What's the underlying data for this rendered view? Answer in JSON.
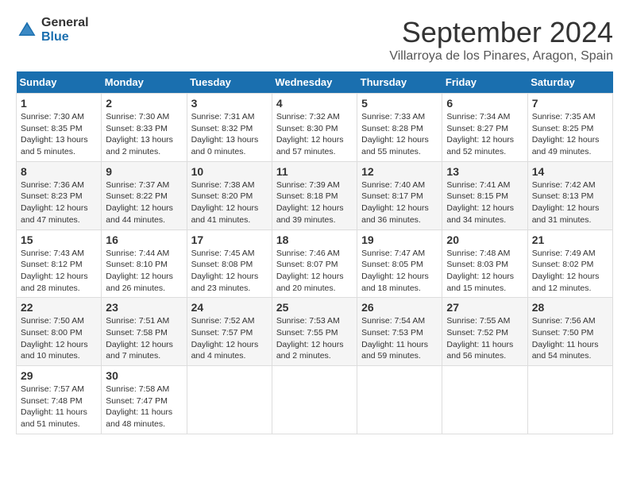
{
  "logo": {
    "general": "General",
    "blue": "Blue"
  },
  "title": "September 2024",
  "location": "Villarroya de los Pinares, Aragon, Spain",
  "weekdays": [
    "Sunday",
    "Monday",
    "Tuesday",
    "Wednesday",
    "Thursday",
    "Friday",
    "Saturday"
  ],
  "weeks": [
    [
      {
        "day": "1",
        "sunrise": "7:30 AM",
        "sunset": "8:35 PM",
        "daylight": "13 hours and 5 minutes."
      },
      {
        "day": "2",
        "sunrise": "7:30 AM",
        "sunset": "8:33 PM",
        "daylight": "13 hours and 2 minutes."
      },
      {
        "day": "3",
        "sunrise": "7:31 AM",
        "sunset": "8:32 PM",
        "daylight": "13 hours and 0 minutes."
      },
      {
        "day": "4",
        "sunrise": "7:32 AM",
        "sunset": "8:30 PM",
        "daylight": "12 hours and 57 minutes."
      },
      {
        "day": "5",
        "sunrise": "7:33 AM",
        "sunset": "8:28 PM",
        "daylight": "12 hours and 55 minutes."
      },
      {
        "day": "6",
        "sunrise": "7:34 AM",
        "sunset": "8:27 PM",
        "daylight": "12 hours and 52 minutes."
      },
      {
        "day": "7",
        "sunrise": "7:35 AM",
        "sunset": "8:25 PM",
        "daylight": "12 hours and 49 minutes."
      }
    ],
    [
      {
        "day": "8",
        "sunrise": "7:36 AM",
        "sunset": "8:23 PM",
        "daylight": "12 hours and 47 minutes."
      },
      {
        "day": "9",
        "sunrise": "7:37 AM",
        "sunset": "8:22 PM",
        "daylight": "12 hours and 44 minutes."
      },
      {
        "day": "10",
        "sunrise": "7:38 AM",
        "sunset": "8:20 PM",
        "daylight": "12 hours and 41 minutes."
      },
      {
        "day": "11",
        "sunrise": "7:39 AM",
        "sunset": "8:18 PM",
        "daylight": "12 hours and 39 minutes."
      },
      {
        "day": "12",
        "sunrise": "7:40 AM",
        "sunset": "8:17 PM",
        "daylight": "12 hours and 36 minutes."
      },
      {
        "day": "13",
        "sunrise": "7:41 AM",
        "sunset": "8:15 PM",
        "daylight": "12 hours and 34 minutes."
      },
      {
        "day": "14",
        "sunrise": "7:42 AM",
        "sunset": "8:13 PM",
        "daylight": "12 hours and 31 minutes."
      }
    ],
    [
      {
        "day": "15",
        "sunrise": "7:43 AM",
        "sunset": "8:12 PM",
        "daylight": "12 hours and 28 minutes."
      },
      {
        "day": "16",
        "sunrise": "7:44 AM",
        "sunset": "8:10 PM",
        "daylight": "12 hours and 26 minutes."
      },
      {
        "day": "17",
        "sunrise": "7:45 AM",
        "sunset": "8:08 PM",
        "daylight": "12 hours and 23 minutes."
      },
      {
        "day": "18",
        "sunrise": "7:46 AM",
        "sunset": "8:07 PM",
        "daylight": "12 hours and 20 minutes."
      },
      {
        "day": "19",
        "sunrise": "7:47 AM",
        "sunset": "8:05 PM",
        "daylight": "12 hours and 18 minutes."
      },
      {
        "day": "20",
        "sunrise": "7:48 AM",
        "sunset": "8:03 PM",
        "daylight": "12 hours and 15 minutes."
      },
      {
        "day": "21",
        "sunrise": "7:49 AM",
        "sunset": "8:02 PM",
        "daylight": "12 hours and 12 minutes."
      }
    ],
    [
      {
        "day": "22",
        "sunrise": "7:50 AM",
        "sunset": "8:00 PM",
        "daylight": "12 hours and 10 minutes."
      },
      {
        "day": "23",
        "sunrise": "7:51 AM",
        "sunset": "7:58 PM",
        "daylight": "12 hours and 7 minutes."
      },
      {
        "day": "24",
        "sunrise": "7:52 AM",
        "sunset": "7:57 PM",
        "daylight": "12 hours and 4 minutes."
      },
      {
        "day": "25",
        "sunrise": "7:53 AM",
        "sunset": "7:55 PM",
        "daylight": "12 hours and 2 minutes."
      },
      {
        "day": "26",
        "sunrise": "7:54 AM",
        "sunset": "7:53 PM",
        "daylight": "11 hours and 59 minutes."
      },
      {
        "day": "27",
        "sunrise": "7:55 AM",
        "sunset": "7:52 PM",
        "daylight": "11 hours and 56 minutes."
      },
      {
        "day": "28",
        "sunrise": "7:56 AM",
        "sunset": "7:50 PM",
        "daylight": "11 hours and 54 minutes."
      }
    ],
    [
      {
        "day": "29",
        "sunrise": "7:57 AM",
        "sunset": "7:48 PM",
        "daylight": "11 hours and 51 minutes."
      },
      {
        "day": "30",
        "sunrise": "7:58 AM",
        "sunset": "7:47 PM",
        "daylight": "11 hours and 48 minutes."
      },
      null,
      null,
      null,
      null,
      null
    ]
  ]
}
